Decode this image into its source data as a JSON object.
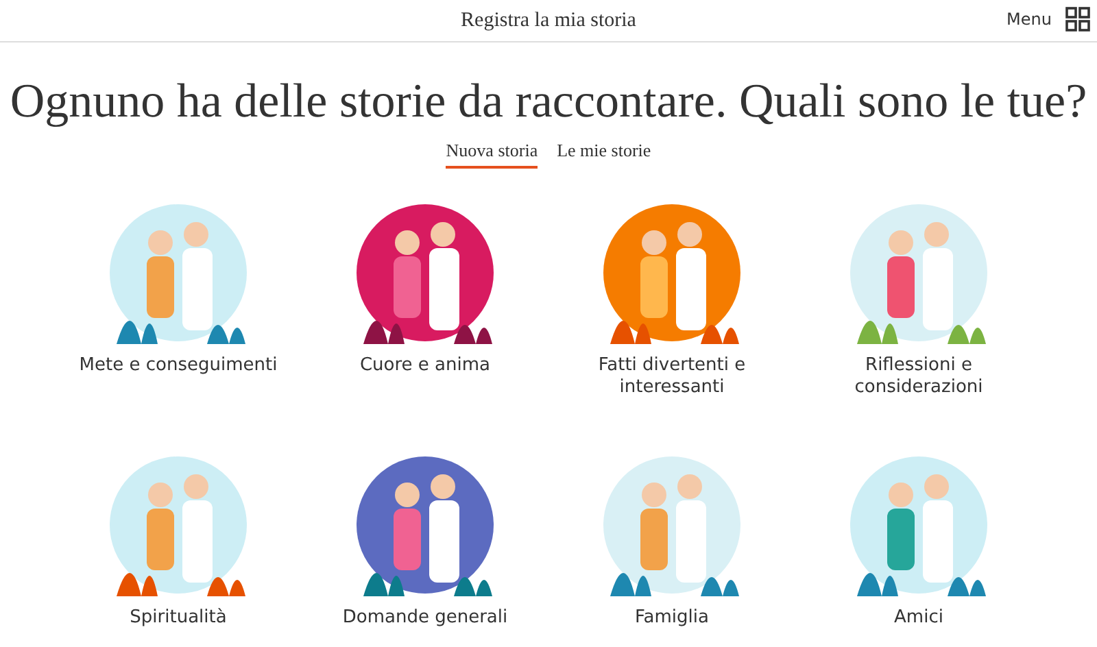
{
  "header": {
    "title": "Registra la mia storia",
    "menu_label": "Menu"
  },
  "heading": "Ognuno ha delle storie da raccontare. Quali sono le tue?",
  "tabs": [
    {
      "label": "Nuova storia",
      "selected": true
    },
    {
      "label": "Le mie storie",
      "selected": false
    }
  ],
  "categories": [
    {
      "label": "Mete e conseguimenti"
    },
    {
      "label": "Cuore e anima"
    },
    {
      "label": "Fatti divertenti e interessanti"
    },
    {
      "label": "Riflessioni e considerazioni"
    },
    {
      "label": "Spiritualità"
    },
    {
      "label": "Domande generali"
    },
    {
      "label": "Famiglia"
    },
    {
      "label": "Amici"
    }
  ]
}
